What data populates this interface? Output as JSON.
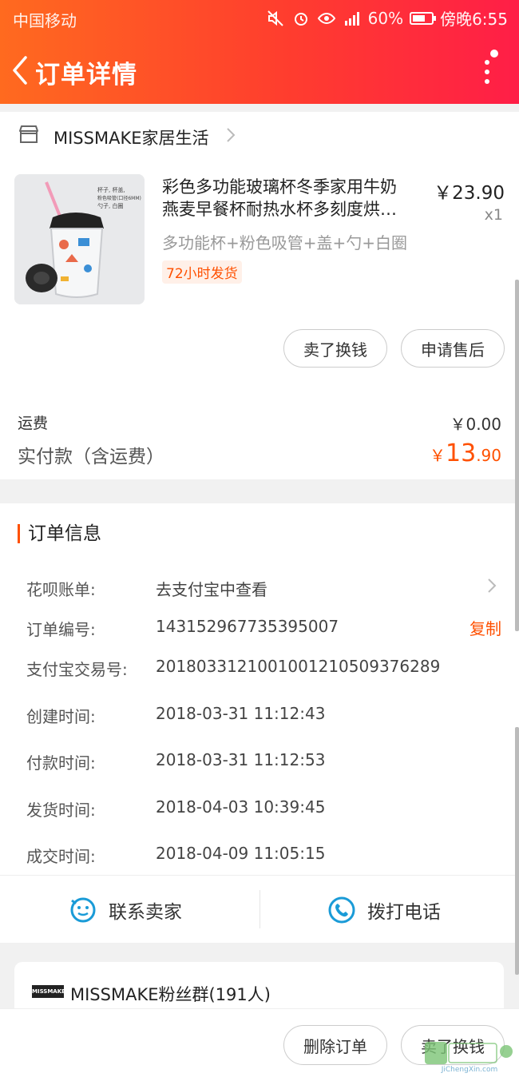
{
  "status_bar": {
    "carrier": "中国移动",
    "battery": "60%",
    "time": "傍晚6:55"
  },
  "nav": {
    "title": "订单详情"
  },
  "store": {
    "name": "MISSMAKE家居生活"
  },
  "product": {
    "title_line1": "彩色多功能玻璃杯冬季家用牛奶",
    "title_line2": "燕麦早餐杯耐热水杯多刻度烘…",
    "price": "￥23.90",
    "quantity": "x1",
    "spec": "多功能杯+粉色吸管+盖+勺+白圈",
    "tag": "72小时发货",
    "image_text": [
      "杯子, 杯盖,",
      "粉色吸管(口径6MM)",
      "勺子, 白圈"
    ]
  },
  "actions": {
    "sell_label": "卖了换钱",
    "after_sale_label": "申请售后"
  },
  "payment": {
    "fee_label": "运费",
    "fee_value": "￥0.00",
    "paid_label": "实付款（含运费）",
    "paid_currency": "￥",
    "paid_int": "13",
    "paid_dec": ".90"
  },
  "order_info": {
    "title": "订单信息",
    "rows": [
      {
        "label": "花呗账单:",
        "value": "去支付宝中查看"
      },
      {
        "label": "订单编号:",
        "value": "143152967735395007"
      },
      {
        "label": "支付宝交易号:",
        "value": "2018033121001001210509376289"
      },
      {
        "label": "创建时间:",
        "value": "2018-03-31 11:12:43"
      },
      {
        "label": "付款时间:",
        "value": "2018-03-31 11:12:53"
      },
      {
        "label": "发货时间:",
        "value": "2018-04-03 10:39:45"
      },
      {
        "label": "成交时间:",
        "value": "2018-04-09 11:05:15"
      }
    ],
    "copy_label": "复制"
  },
  "contact": {
    "seller_label": "联系卖家",
    "phone_label": "拨打电话"
  },
  "fans": {
    "logo_text": "MISSMAKE",
    "text": "MISSMAKE粉丝群(191人)"
  },
  "bottom": {
    "delete_label": "删除订单",
    "sell_label": "卖了换钱"
  },
  "watermark": {
    "text": "JiChengXin.com"
  },
  "colors": {
    "accent": "#ff5000",
    "header_start": "#ff6a1f",
    "header_end": "#ff1e47",
    "contact_icon": "#1a9bd7"
  }
}
